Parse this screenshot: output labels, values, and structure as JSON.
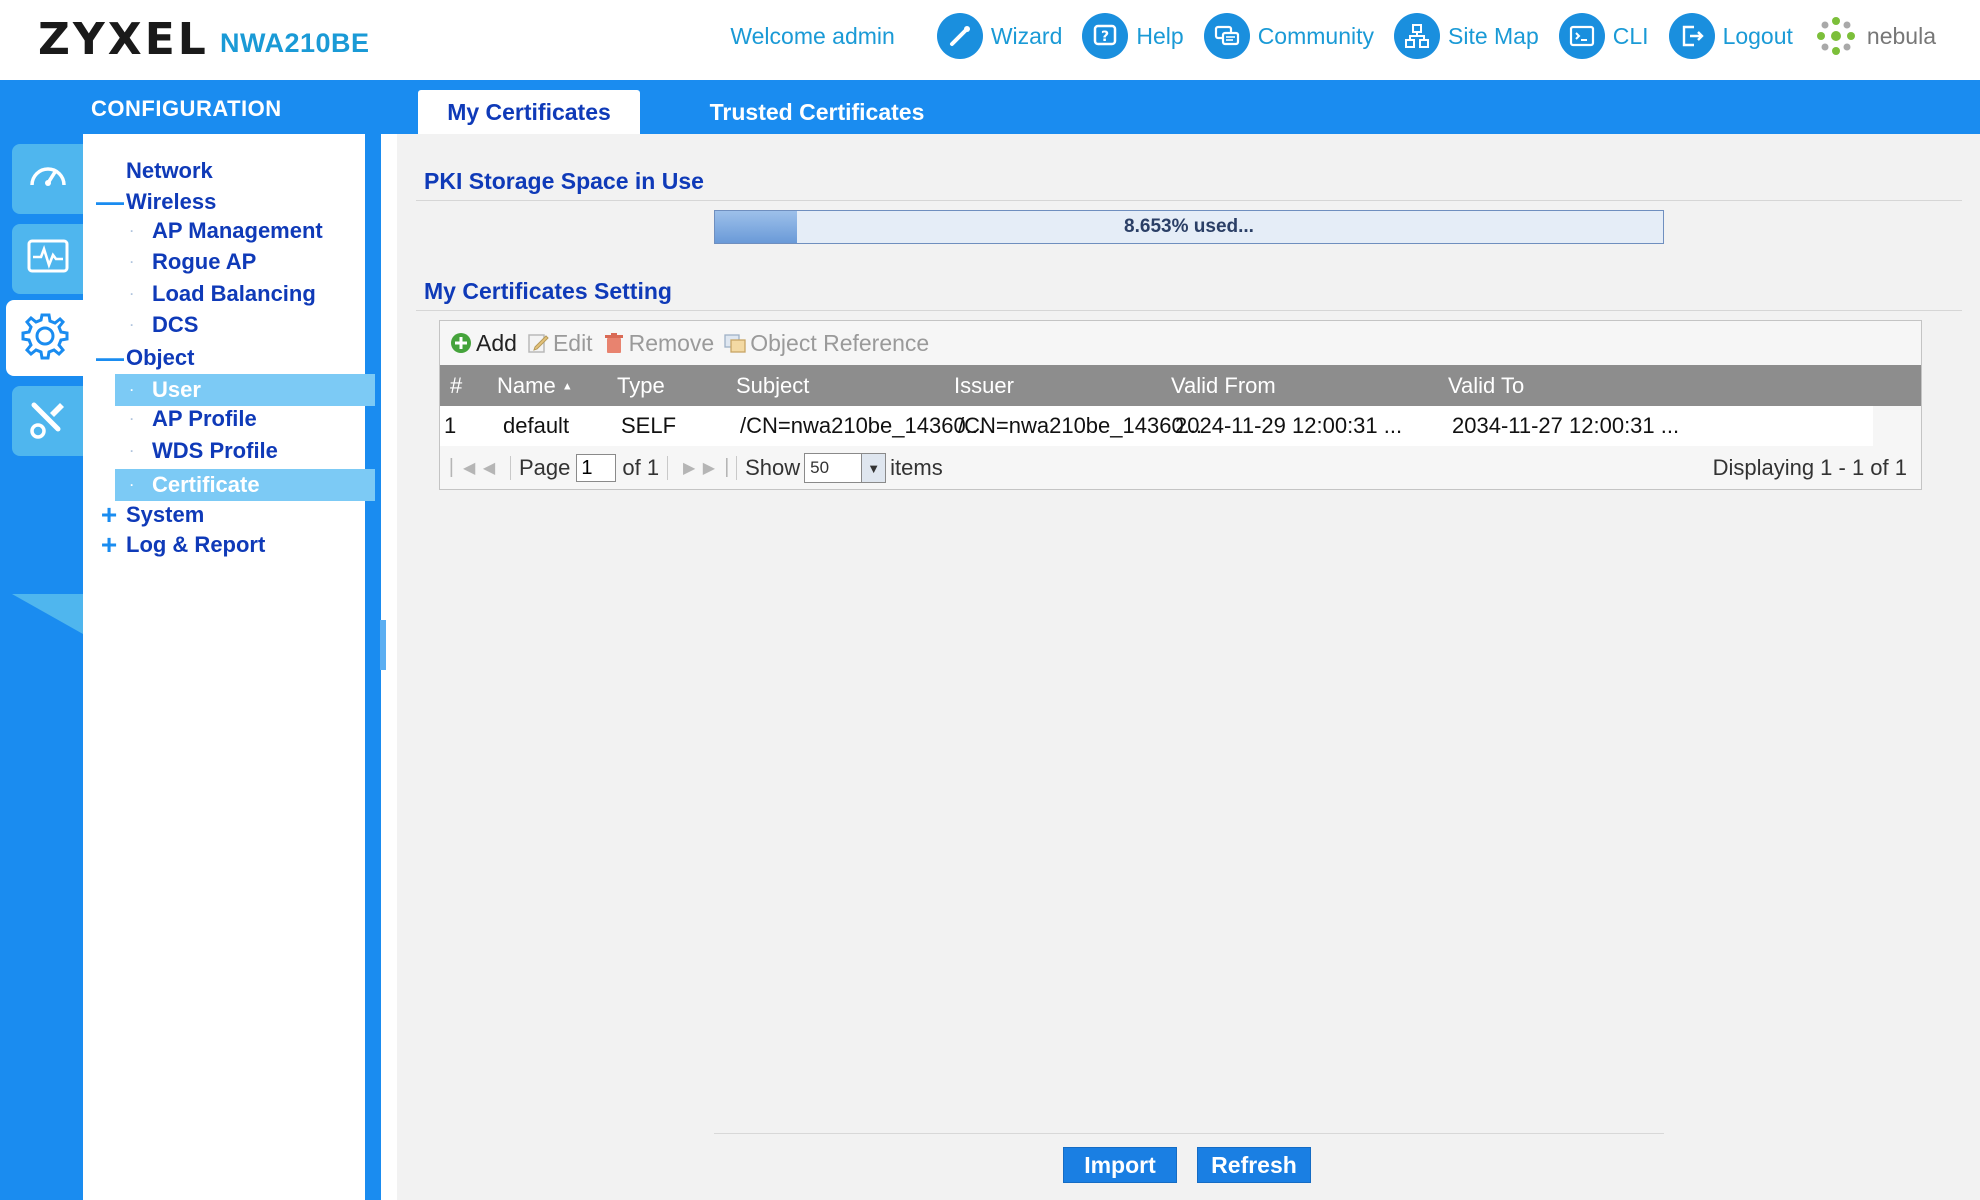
{
  "header": {
    "brand": "ZYXEL",
    "model": "NWA210BE",
    "welcome": "Welcome admin",
    "nav": [
      {
        "label": "Wizard",
        "icon": "wizard-icon"
      },
      {
        "label": "Help",
        "icon": "help-icon"
      },
      {
        "label": "Community",
        "icon": "community-icon"
      },
      {
        "label": "Site Map",
        "icon": "sitemap-icon"
      },
      {
        "label": "CLI",
        "icon": "cli-icon"
      },
      {
        "label": "Logout",
        "icon": "logout-icon"
      },
      {
        "label": "nebula",
        "icon": "nebula-icon"
      }
    ]
  },
  "configuration_title": "CONFIGURATION",
  "left_tabs": [
    {
      "icon": "dashboard-icon",
      "active": false
    },
    {
      "icon": "monitor-icon",
      "active": false
    },
    {
      "icon": "gear-icon",
      "active": true
    },
    {
      "icon": "maintenance-icon",
      "active": false
    }
  ],
  "sidebar": {
    "items": [
      {
        "label": "Network",
        "toggle": ""
      },
      {
        "label": "Wireless",
        "toggle": "—"
      },
      {
        "label": "AP Management"
      },
      {
        "label": "Rogue AP"
      },
      {
        "label": "Load Balancing"
      },
      {
        "label": "DCS"
      },
      {
        "label": "Object",
        "toggle": "—"
      },
      {
        "label": "User"
      },
      {
        "label": "AP Profile"
      },
      {
        "label": "WDS Profile"
      },
      {
        "label": "Certificate"
      },
      {
        "label": "System",
        "toggle": "+"
      },
      {
        "label": "Log & Report",
        "toggle": "+"
      }
    ]
  },
  "tabs": [
    {
      "label": "My Certificates",
      "active": true
    },
    {
      "label": "Trusted Certificates",
      "active": false
    }
  ],
  "pki": {
    "title": "PKI Storage Space in Use",
    "used_percent": 8.653,
    "used_text": "8.653% used..."
  },
  "settings": {
    "title": "My Certificates Setting",
    "toolbar": {
      "add": "Add",
      "edit": "Edit",
      "remove": "Remove",
      "object_reference": "Object Reference"
    },
    "columns": {
      "num": "#",
      "name": "Name",
      "name_sort": "▲",
      "type": "Type",
      "subject": "Subject",
      "issuer": "Issuer",
      "valid_from": "Valid From",
      "valid_to": "Valid To"
    },
    "rows": [
      {
        "num": "1",
        "name": "default",
        "type": "SELF",
        "subject": "/CN=nwa210be_14360...",
        "issuer": "/CN=nwa210be_14360...",
        "valid_from": "2024-11-29 12:00:31 ...",
        "valid_to": "2034-11-27 12:00:31 ..."
      }
    ],
    "pager": {
      "page_label": "Page",
      "page_value": "1",
      "of_label": "of 1",
      "show_label": "Show",
      "show_value": "50",
      "items_label": "items",
      "displaying": "Displaying 1 - 1 of 1"
    }
  },
  "buttons": {
    "import": "Import",
    "refresh": "Refresh"
  },
  "colors": {
    "brand_blue": "#1a8cf0",
    "link_blue": "#1a9ad6",
    "tree_blue": "#0f3ab8",
    "selected_bg": "#7ccaf5",
    "grid_header": "#8d8d8d",
    "button_blue": "#1a7fe3"
  }
}
